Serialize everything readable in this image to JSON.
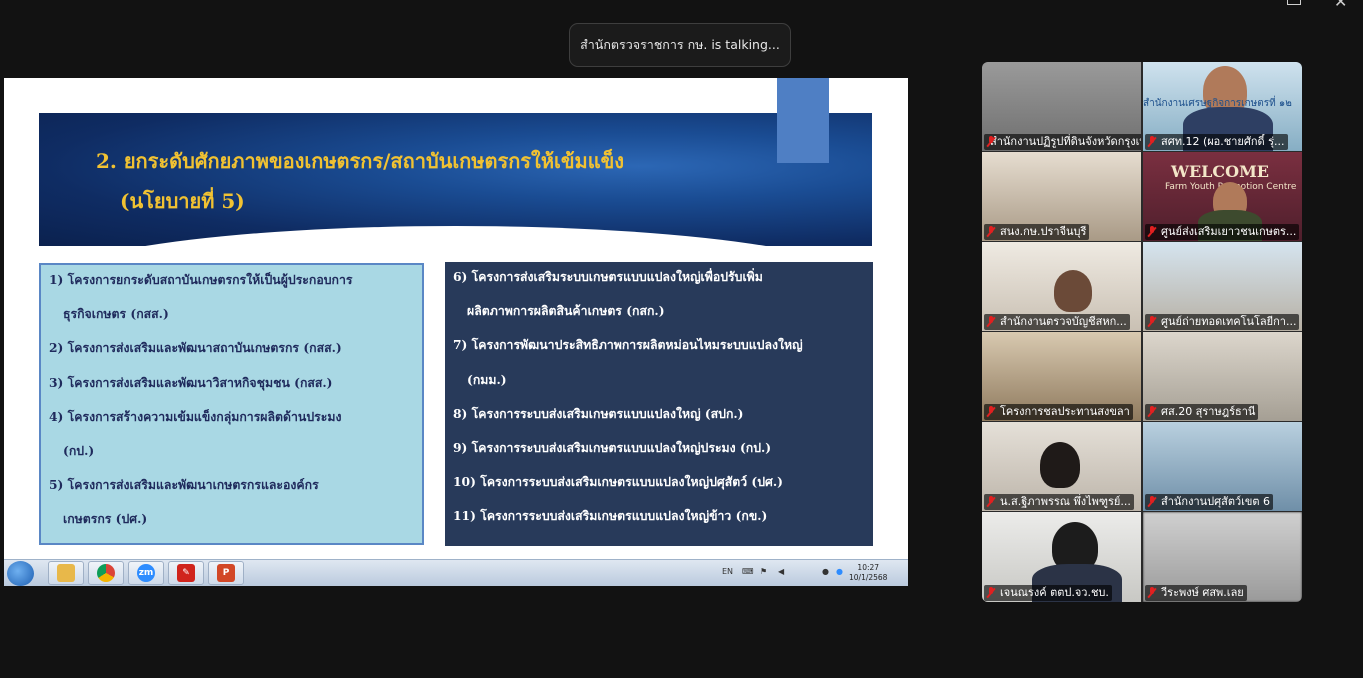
{
  "talking_indicator": "สำนักตรวจราชการ กษ. is talking...",
  "slide": {
    "title_line1": "2. ยกระดับศักยภาพของเกษตรกร/สถาบันเกษตรกรให้เข้มแข็ง",
    "title_line2": "(นโยบายที่ 5)",
    "left_items": [
      "1) โครงการยกระดับสถาบันเกษตรกรให้เป็นผู้ประกอบการ",
      "ธุรกิจเกษตร (กสส.)",
      "2) โครงการส่งเสริมและพัฒนาสถาบันเกษตรกร (กสส.)",
      "3) โครงการส่งเสริมและพัฒนาวิสาหกิจชุมชน (กสส.)",
      "4) โครงการสร้างความเข้มแข็งกลุ่มการผลิตด้านประมง",
      "(กป.)",
      "5) โครงการส่งเสริมและพัฒนาเกษตรกรและองค์กร",
      "เกษตรกร (ปศ.)"
    ],
    "right_items": [
      "6) โครงการส่งเสริมระบบเกษตรแบบแปลงใหญ่เพื่อปรับเพิ่ม",
      "ผลิตภาพการผลิตสินค้าเกษตร (กสก.)",
      "7) โครงการพัฒนาประสิทธิภาพการผลิตหม่อนไหมระบบแปลงใหญ่",
      "(กมม.)",
      "8) โครงการระบบส่งเสริมเกษตรแบบแปลงใหญ่ (สปก.)",
      "9) โครงการระบบส่งเสริมเกษตรแบบแปลงใหญ่ประมง (กป.)",
      "10) โครงการระบบส่งเสริมเกษตรแบบแปลงใหญ่ปศุสัตว์ (ปศ.)",
      "11) โครงการระบบส่งเสริมเกษตรแบบแปลงใหญ่ข้าว (กข.)"
    ]
  },
  "taskbar": {
    "apps": [
      "start-button",
      "file-explorer",
      "chrome",
      "zoom",
      "acrobat",
      "powerpoint"
    ],
    "zoom_label": "zm",
    "lang": "EN",
    "time": "10:27",
    "date": "10/1/2568"
  },
  "participants": [
    {
      "name": "สำนักงานปฏิรูปที่ดินจังหวัดกรุงเทพ...",
      "scene_color": "#8a8a8a"
    },
    {
      "name": "สศท.12 (ผอ.ชายศักดิ์  รุ่...",
      "scene_color": "#a8c8d8",
      "caption": "สำนักงานเศรษฐกิจการเกษตรที่ ๑๒"
    },
    {
      "name": "สนง.กษ.ปราจีนบุรี",
      "scene_color": "#c9b9a3"
    },
    {
      "name": "ศูนย์ส่งเสริมเยาวชนเกษตร...",
      "scene_color": "#6b2a3a",
      "caption": "WELCOME",
      "caption2": "Farm Youth Promotion Centre"
    },
    {
      "name": "สำนักงานตรวจบัญชีสหก...",
      "scene_color": "#d9d2c7"
    },
    {
      "name": "ศูนย์ถ่ายทอดเทคโนโลยีกา...",
      "scene_color": "#c7d9e8"
    },
    {
      "name": "โครงการชลประทานสงขลา",
      "scene_color": "#b8a58a"
    },
    {
      "name": "ศส.20 สุราษฎร์ธานี",
      "scene_color": "#c8c2b8"
    },
    {
      "name": "น.ส.ฐิภาพรรณ พึ่งไพฑูรย์...",
      "scene_color": "#cfc9c0"
    },
    {
      "name": "สำนักงานปศุสัตว์เขต  6",
      "scene_color": "#9bb6c9"
    },
    {
      "name": "เจนณรงค์ ตตป.จว.ชบ.",
      "scene_color": "#d8d8d6"
    },
    {
      "name": "วีระพงษ์ ศสพ.เลย",
      "scene_color": "#bdbdbd"
    }
  ]
}
